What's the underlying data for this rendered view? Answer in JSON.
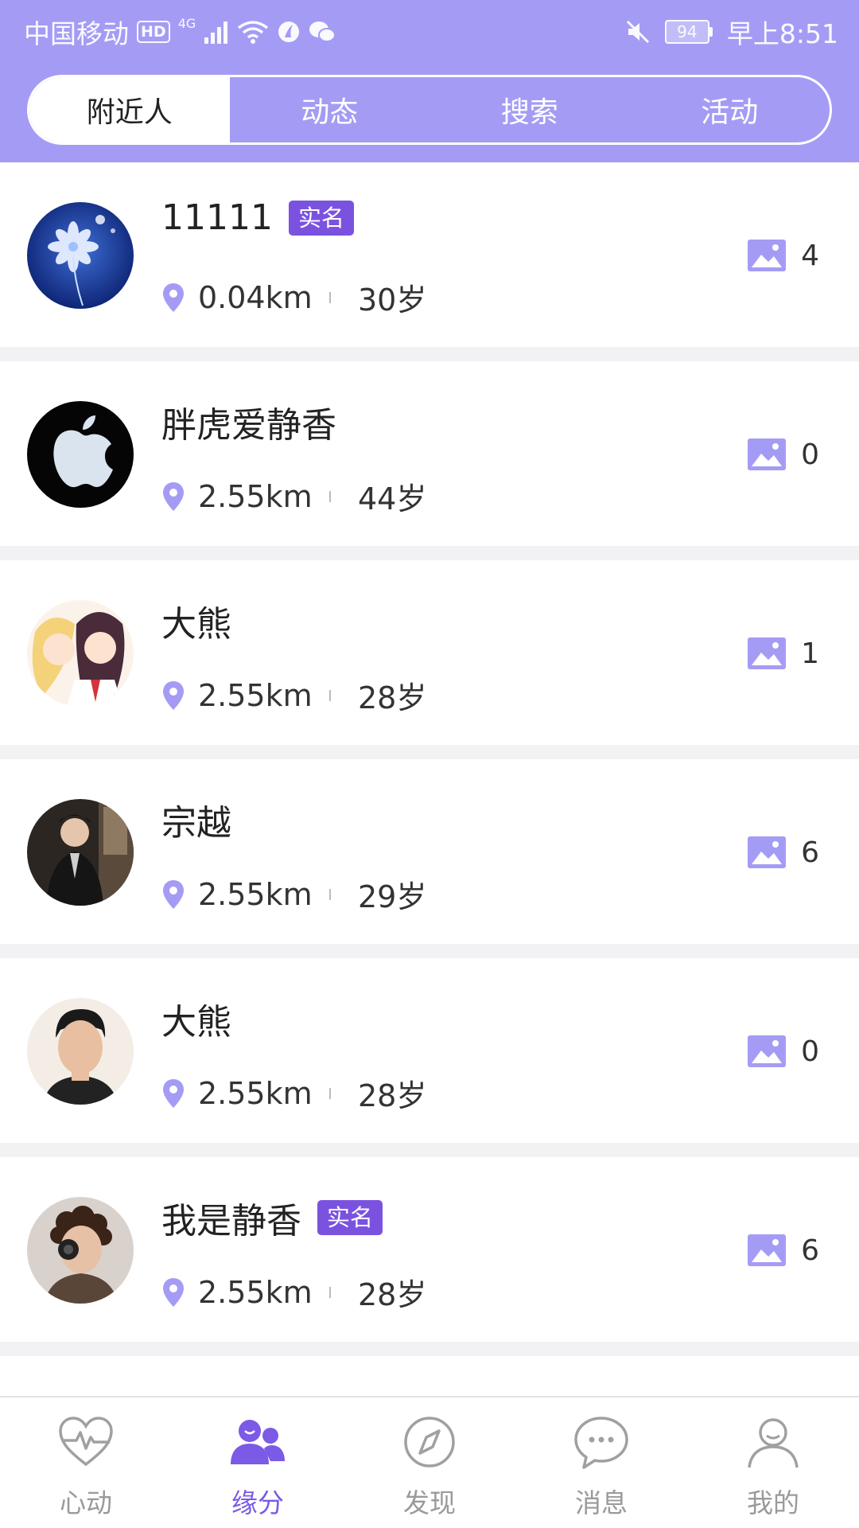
{
  "statusbar": {
    "carrier": "中国移动",
    "hd": "HD",
    "network": "4G",
    "battery": "94",
    "time": "早上8:51"
  },
  "tabs": [
    {
      "label": "附近人",
      "active": true
    },
    {
      "label": "动态",
      "active": false
    },
    {
      "label": "搜索",
      "active": false
    },
    {
      "label": "活动",
      "active": false
    }
  ],
  "users": [
    {
      "name": "11111",
      "badge": "实名",
      "distance": "0.04km",
      "age": "30岁",
      "photos": "4",
      "avatar": "flower-avatar"
    },
    {
      "name": "胖虎爱静香",
      "badge": "",
      "distance": "2.55km",
      "age": "44岁",
      "photos": "0",
      "avatar": "apple-logo-avatar"
    },
    {
      "name": "大熊",
      "badge": "",
      "distance": "2.55km",
      "age": "28岁",
      "photos": "1",
      "avatar": "anime-avatar"
    },
    {
      "name": "宗越",
      "badge": "",
      "distance": "2.55km",
      "age": "29岁",
      "photos": "6",
      "avatar": "costume-avatar"
    },
    {
      "name": "大熊",
      "badge": "",
      "distance": "2.55km",
      "age": "28岁",
      "photos": "0",
      "avatar": "portrait-avatar"
    },
    {
      "name": "我是静香",
      "badge": "实名",
      "distance": "2.55km",
      "age": "28岁",
      "photos": "6",
      "avatar": "curly-hair-avatar"
    }
  ],
  "bottom_nav": [
    {
      "label": "心动",
      "icon": "heart-pulse-icon",
      "active": false
    },
    {
      "label": "缘分",
      "icon": "people-icon",
      "active": true
    },
    {
      "label": "发现",
      "icon": "compass-icon",
      "active": false
    },
    {
      "label": "消息",
      "icon": "chat-bubble-icon",
      "active": false
    },
    {
      "label": "我的",
      "icon": "person-icon",
      "active": false
    }
  ],
  "colors": {
    "accent": "#a49cf4",
    "badge": "#7b52e0",
    "active_nav": "#7b5ae6"
  }
}
